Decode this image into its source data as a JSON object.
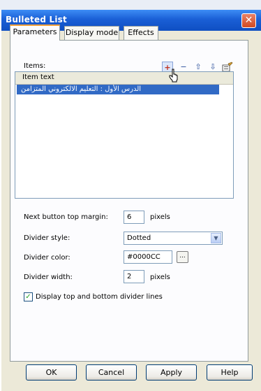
{
  "window": {
    "title": "Bulleted List",
    "close_glyph": "✕"
  },
  "tabs": [
    {
      "label": "Parameters",
      "active": true
    },
    {
      "label": "Display mode",
      "active": false
    },
    {
      "label": "Effects",
      "active": false
    }
  ],
  "items": {
    "label": "Items:",
    "toolbar": {
      "add": "+",
      "remove": "−",
      "up": "⇧",
      "down": "⇩",
      "edit_icon": "edit-icon"
    },
    "column_header": "Item text",
    "rows": [
      "الدرس الأول : التعليم الالكتروني المتزامن"
    ]
  },
  "fields": {
    "next_button_top_margin": {
      "label": "Next button top margin:",
      "value": "6",
      "unit": "pixels"
    },
    "divider_style": {
      "label": "Divider style:",
      "value": "Dotted"
    },
    "divider_color": {
      "label": "Divider color:",
      "value": "#0000CC",
      "button": "..."
    },
    "divider_width": {
      "label": "Divider width:",
      "value": "2",
      "unit": "pixels"
    },
    "display_divider_lines": {
      "label": "Display top and bottom divider lines",
      "checked": true
    }
  },
  "buttons": {
    "ok": "OK",
    "cancel": "Cancel",
    "apply": "Apply",
    "help": "Help"
  },
  "colors": {
    "title_bar": "#1a5fd6",
    "selection": "#316ac5",
    "tab_accent": "#f5a13a",
    "divider_color": "#0000CC"
  }
}
